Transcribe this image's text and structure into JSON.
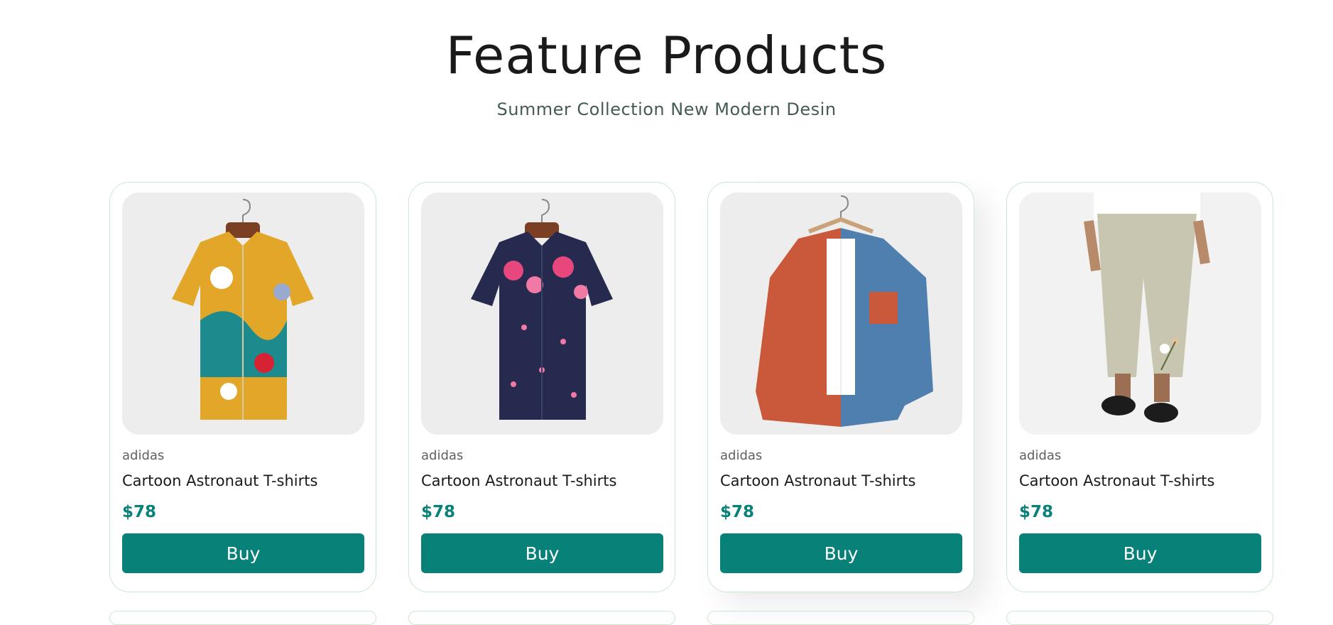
{
  "section": {
    "title": "Feature Products",
    "subtitle": "Summer Collection New Modern Desin"
  },
  "products": [
    {
      "brand": "adidas",
      "name": "Cartoon Astronaut T-shirts",
      "price": "$78",
      "button": "Buy",
      "image_icon": "floral-shirt-yellow-image"
    },
    {
      "brand": "adidas",
      "name": "Cartoon Astronaut T-shirts",
      "price": "$78",
      "button": "Buy",
      "image_icon": "floral-shirt-navy-image"
    },
    {
      "brand": "adidas",
      "name": "Cartoon Astronaut T-shirts",
      "price": "$78",
      "button": "Buy",
      "image_icon": "corduroy-shirt-image"
    },
    {
      "brand": "adidas",
      "name": "Cartoon Astronaut T-shirts",
      "price": "$78",
      "button": "Buy",
      "image_icon": "linen-pants-image"
    }
  ],
  "colors": {
    "accent": "#088178",
    "card_border": "#cce7d0",
    "image_bg": "#ededed"
  }
}
